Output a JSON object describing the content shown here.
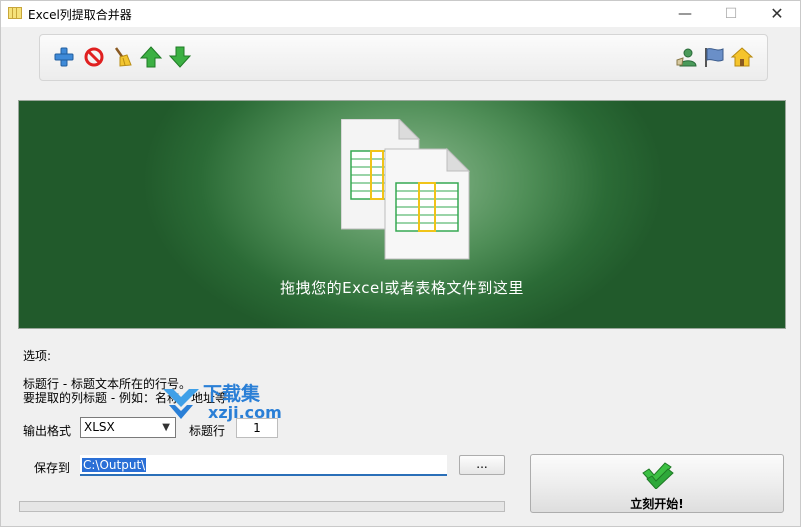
{
  "window": {
    "title": "Excel列提取合并器",
    "minimize": "—",
    "maximize": "☐",
    "close": "✕"
  },
  "toolbar": {
    "left_icons": [
      "add-icon",
      "remove-icon",
      "clear-icon",
      "move-up-icon",
      "move-down-icon"
    ],
    "right_icons": [
      "user-icon",
      "flag-icon",
      "home-icon"
    ]
  },
  "drop_zone": {
    "text": "拖拽您的Excel或者表格文件到这里"
  },
  "options": {
    "title": "选项:",
    "help_line1": "标题行 - 标题文本所在的行号。",
    "help_line2": "要提取的列标题 - 例如：名称、地址等"
  },
  "watermark": {
    "title": "下载集",
    "subtitle": "xzji.com"
  },
  "format": {
    "label": "输出格式",
    "value": "XLSX",
    "header_row_label": "标题行",
    "header_row_value": "1"
  },
  "save": {
    "label": "保存到",
    "path": "C:\\Output\\",
    "browse_label": "..."
  },
  "progress": {
    "value": 0
  },
  "start": {
    "label": "立刻开始!"
  },
  "colors": {
    "accent_green": "#2f7a3b",
    "selection_blue": "#2a6fd6"
  }
}
